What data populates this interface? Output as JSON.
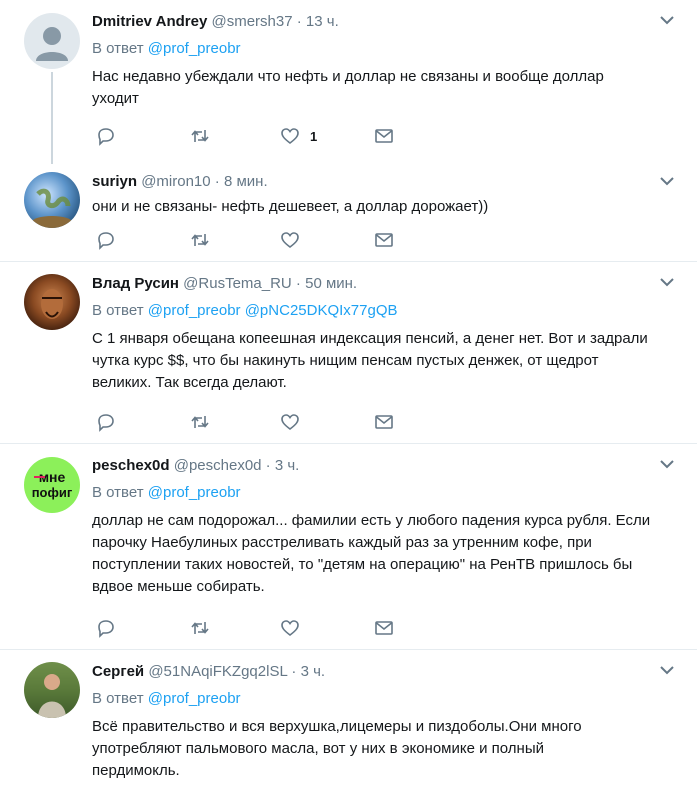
{
  "labels": {
    "in_reply_to": "В ответ"
  },
  "colors": {
    "link": "#1da1f2",
    "muted": "#657786",
    "separator": "#e6ecf0"
  },
  "tweets": [
    {
      "name": "Dmitriev Andrey",
      "handle": "@smersh37",
      "time": "13 ч.",
      "reply_to": "@prof_preobr",
      "text": "Нас недавно убеждали что нефть и доллар не связаны и вообще доллар уходит",
      "likes": "1"
    },
    {
      "name": "suriyn",
      "handle": "@miron10",
      "time": "8 мин.",
      "text": "они и не связаны- нефть дешевеет, а доллар дорожает))"
    },
    {
      "name": "Влад Русин",
      "handle": "@RusTema_RU",
      "time": "50 мин.",
      "reply_to": "@prof_preobr",
      "reply_to_2": "@pNC25DKQIx77gQB",
      "text": "С 1 января обещана копеешная индексация пенсий, а денег нет. Вот и задрали чутка курс $$, что бы накинуть нищим пенсам пустых денжек, от щедрот великих. Так всегда делают."
    },
    {
      "name": "peschex0d",
      "handle": "@peschex0d",
      "time": "3 ч.",
      "reply_to": "@prof_preobr",
      "text": "доллар не сам подорожал... фамилии есть у любого падения курса рубля. Если парочку Наебулиных расстреливать каждый раз за утренним кофе, при поступлении таких новостей, то \"детям на операцию\" на РенТВ пришлось бы вдвое меньше собирать.",
      "avatar_text_1": "мне",
      "avatar_text_2": "пофиг"
    },
    {
      "name": "Сергей",
      "handle": "@51NAqiFKZgq2lSL",
      "time": "3 ч.",
      "reply_to": "@prof_preobr",
      "text": "Всё правительство и вся верхушка,лицемеры и пиздоболы.Они много употребляют пальмового масла, вот у них в экономике и полный пердимокль."
    }
  ]
}
